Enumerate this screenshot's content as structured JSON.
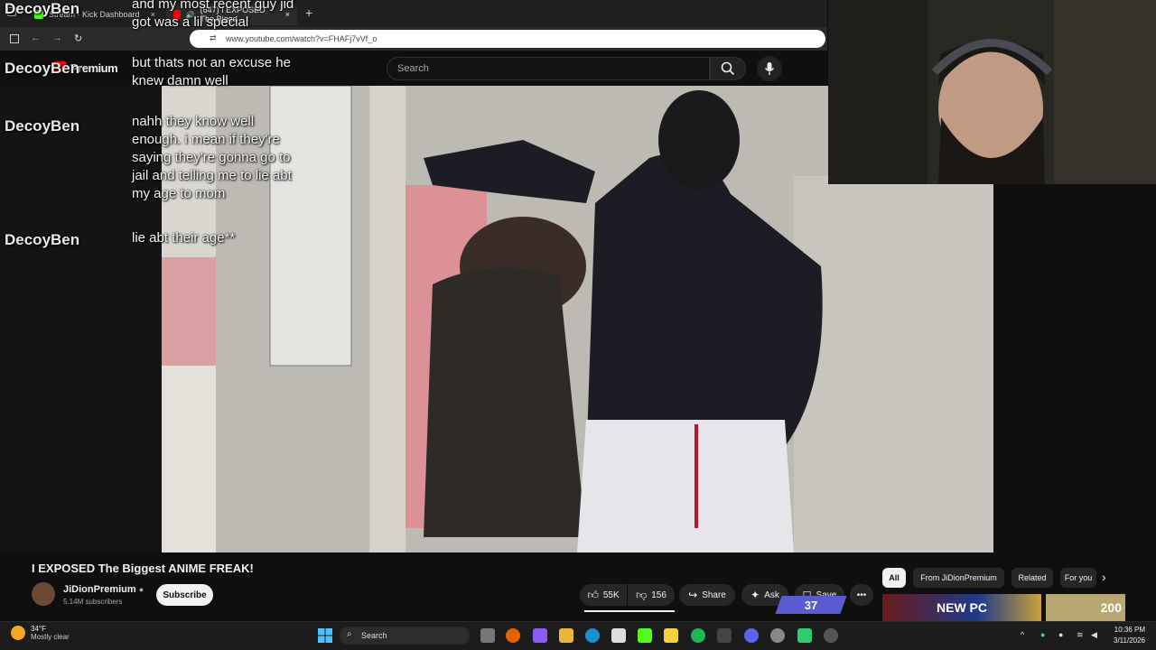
{
  "browser": {
    "tabs": [
      {
        "label": "Stream - Kick Dashboard"
      },
      {
        "label": "(647) I EXPOSED The Bigge"
      }
    ],
    "new_tab": "+",
    "close_tab": "×",
    "url": "www.youtube.com/watch?v=FHAFj7vVf_o"
  },
  "youtube": {
    "logo_text": "Premium",
    "search_placeholder": "Search",
    "video_title": "I EXPOSED The Biggest ANIME FREAK!",
    "channel_name": "JiDionPremium",
    "subscribers": "5.14M subscribers",
    "subscribe_label": "Subscribe",
    "likes": "55K",
    "dislikes": "156",
    "share_label": "Share",
    "ask_label": "Ask",
    "save_label": "Save",
    "more_label": "•••",
    "badge_count": "37",
    "chips": [
      "All",
      "From JiDionPremium",
      "Related",
      "For you"
    ],
    "thumbs": [
      "NEW PC",
      "200"
    ]
  },
  "chat": [
    {
      "user": "DecoyBen",
      "message": "and my most recent guy jid got was a lil special"
    },
    {
      "user": "DecoyBen",
      "message": "but thats not an excuse he knew damn well"
    },
    {
      "user": "DecoyBen",
      "message": "nahh they know well enough. i mean if they're saying they're gonna go to jail and telling me to lie abt my age to mom"
    },
    {
      "user": "DecoyBen",
      "message": "lie abt their age**"
    }
  ],
  "taskbar": {
    "temperature": "34°F",
    "weather": "Mostly clear",
    "search_label": "Search",
    "time": "10:36 PM",
    "date": "3/11/2026"
  },
  "colors": {
    "youtube_red": "#ff0000",
    "badge_purple": "#5b5bd0",
    "background": "#0f0f0f"
  }
}
